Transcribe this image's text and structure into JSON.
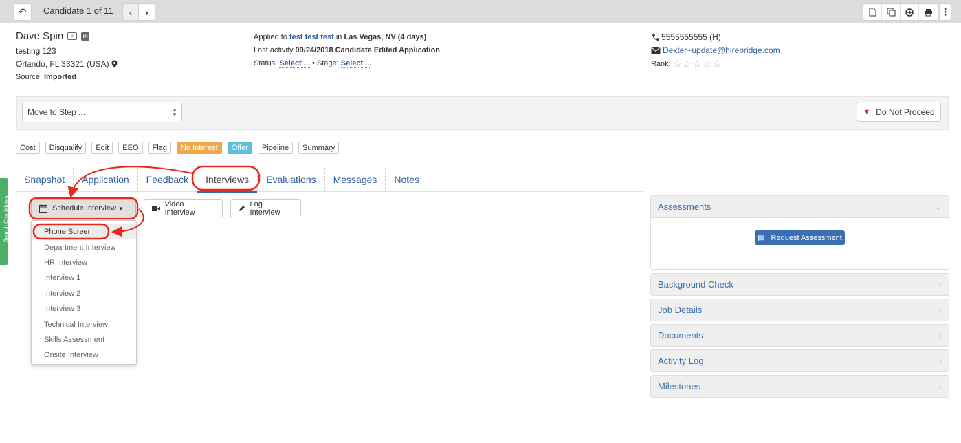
{
  "topbar": {
    "back_icon": "reply-arrow-icon",
    "candidate_counter": "Candidate 1 of 11",
    "prev_icon": "chevron-left-icon",
    "next_icon": "chevron-right-icon",
    "tools": [
      {
        "name": "new-document-icon",
        "glyph": "🗋"
      },
      {
        "name": "copy-icon",
        "glyph": "❐"
      },
      {
        "name": "forward-circle-icon",
        "glyph": "⊕"
      },
      {
        "name": "print-icon",
        "glyph": "⎙"
      }
    ],
    "more_glyph": "⋮"
  },
  "candidate": {
    "name": "Dave Spin",
    "headline": "testing 123",
    "location": "Orlando, FL 33321 (USA)",
    "source_label": "Source:",
    "source_value": "Imported"
  },
  "application": {
    "applied_prefix": "Applied to",
    "job_link": "test test test",
    "in_word": "in",
    "job_location": "Las Vegas, NV (4 days)",
    "last_activity_label": "Last activity",
    "last_activity_value": "09/24/2018 Candidate Edited Application",
    "status_label": "Status:",
    "status_value": "Select ...",
    "stage_sep": " • Stage:",
    "stage_value": "Select ..."
  },
  "contact": {
    "phone": "5555555555 (H)",
    "email": "Dexter+update@hirebridge.com",
    "rank_label": "Rank:",
    "rank_value": 0,
    "rank_max": 5,
    "stars": "☆☆☆☆☆"
  },
  "step_panel": {
    "select_value": "Move to Step ...",
    "do_not_proceed_label": "Do Not Proceed"
  },
  "tags": [
    {
      "label": "Cost",
      "style": "default"
    },
    {
      "label": "Disqualify",
      "style": "default"
    },
    {
      "label": "Edit",
      "style": "default"
    },
    {
      "label": "EEO",
      "style": "default"
    },
    {
      "label": "Flag",
      "style": "default"
    },
    {
      "label": "No Interest",
      "style": "warn"
    },
    {
      "label": "Offer",
      "style": "info"
    },
    {
      "label": "Pipeline",
      "style": "default"
    },
    {
      "label": "Summary",
      "style": "default"
    }
  ],
  "tabs": [
    {
      "label": "Snapshot",
      "active": false
    },
    {
      "label": "Application",
      "active": false
    },
    {
      "label": "Feedback",
      "active": false
    },
    {
      "label": "Interviews",
      "active": true
    },
    {
      "label": "Evaluations",
      "active": false
    },
    {
      "label": "Messages",
      "active": false
    },
    {
      "label": "Notes",
      "active": false
    }
  ],
  "search_tab_label": "Search Candidates",
  "interview_actions": {
    "schedule_label": "Schedule Interview",
    "video_label": "Video Interview",
    "log_label": "Log Interview"
  },
  "schedule_menu": [
    "Phone Screen",
    "Department Interview",
    "HR Interview",
    "Interview 1",
    "Interview 2",
    "Interview 3",
    "Technical Interview",
    "Skills Assessment",
    "Onsite Interview"
  ],
  "side_panels": {
    "assessments": {
      "title": "Assessments",
      "button": "Request Assessment"
    },
    "collapsed": [
      "Background Check",
      "Job Details",
      "Documents",
      "Activity Log",
      "Milestones"
    ]
  },
  "colors": {
    "link": "#2f5f9e",
    "annotation": "#e8281e",
    "warn_tag": "#eea94a",
    "info_tag": "#5bbfe0",
    "primary_button": "#3a6fb5",
    "search_tab": "#4caf68"
  }
}
